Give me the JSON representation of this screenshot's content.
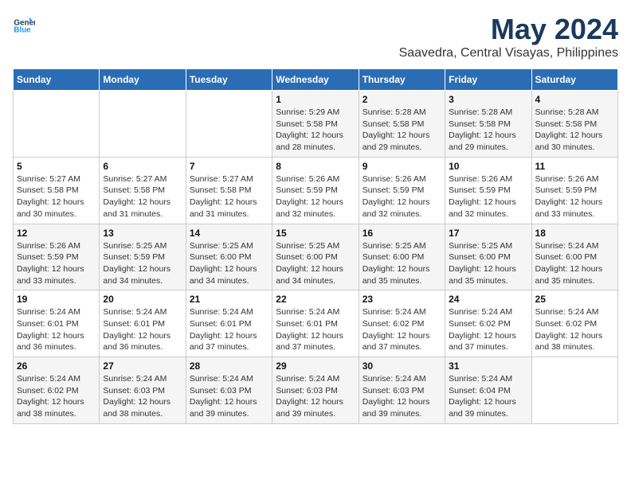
{
  "logo": {
    "line1": "General",
    "line2": "Blue"
  },
  "title": "May 2024",
  "location": "Saavedra, Central Visayas, Philippines",
  "days_of_week": [
    "Sunday",
    "Monday",
    "Tuesday",
    "Wednesday",
    "Thursday",
    "Friday",
    "Saturday"
  ],
  "weeks": [
    [
      {
        "day": "",
        "info": ""
      },
      {
        "day": "",
        "info": ""
      },
      {
        "day": "",
        "info": ""
      },
      {
        "day": "1",
        "sunrise": "5:29 AM",
        "sunset": "5:58 PM",
        "daylight": "12 hours and 28 minutes."
      },
      {
        "day": "2",
        "sunrise": "5:28 AM",
        "sunset": "5:58 PM",
        "daylight": "12 hours and 29 minutes."
      },
      {
        "day": "3",
        "sunrise": "5:28 AM",
        "sunset": "5:58 PM",
        "daylight": "12 hours and 29 minutes."
      },
      {
        "day": "4",
        "sunrise": "5:28 AM",
        "sunset": "5:58 PM",
        "daylight": "12 hours and 30 minutes."
      }
    ],
    [
      {
        "day": "5",
        "sunrise": "5:27 AM",
        "sunset": "5:58 PM",
        "daylight": "12 hours and 30 minutes."
      },
      {
        "day": "6",
        "sunrise": "5:27 AM",
        "sunset": "5:58 PM",
        "daylight": "12 hours and 31 minutes."
      },
      {
        "day": "7",
        "sunrise": "5:27 AM",
        "sunset": "5:58 PM",
        "daylight": "12 hours and 31 minutes."
      },
      {
        "day": "8",
        "sunrise": "5:26 AM",
        "sunset": "5:59 PM",
        "daylight": "12 hours and 32 minutes."
      },
      {
        "day": "9",
        "sunrise": "5:26 AM",
        "sunset": "5:59 PM",
        "daylight": "12 hours and 32 minutes."
      },
      {
        "day": "10",
        "sunrise": "5:26 AM",
        "sunset": "5:59 PM",
        "daylight": "12 hours and 32 minutes."
      },
      {
        "day": "11",
        "sunrise": "5:26 AM",
        "sunset": "5:59 PM",
        "daylight": "12 hours and 33 minutes."
      }
    ],
    [
      {
        "day": "12",
        "sunrise": "5:26 AM",
        "sunset": "5:59 PM",
        "daylight": "12 hours and 33 minutes."
      },
      {
        "day": "13",
        "sunrise": "5:25 AM",
        "sunset": "5:59 PM",
        "daylight": "12 hours and 34 minutes."
      },
      {
        "day": "14",
        "sunrise": "5:25 AM",
        "sunset": "6:00 PM",
        "daylight": "12 hours and 34 minutes."
      },
      {
        "day": "15",
        "sunrise": "5:25 AM",
        "sunset": "6:00 PM",
        "daylight": "12 hours and 34 minutes."
      },
      {
        "day": "16",
        "sunrise": "5:25 AM",
        "sunset": "6:00 PM",
        "daylight": "12 hours and 35 minutes."
      },
      {
        "day": "17",
        "sunrise": "5:25 AM",
        "sunset": "6:00 PM",
        "daylight": "12 hours and 35 minutes."
      },
      {
        "day": "18",
        "sunrise": "5:24 AM",
        "sunset": "6:00 PM",
        "daylight": "12 hours and 35 minutes."
      }
    ],
    [
      {
        "day": "19",
        "sunrise": "5:24 AM",
        "sunset": "6:01 PM",
        "daylight": "12 hours and 36 minutes."
      },
      {
        "day": "20",
        "sunrise": "5:24 AM",
        "sunset": "6:01 PM",
        "daylight": "12 hours and 36 minutes."
      },
      {
        "day": "21",
        "sunrise": "5:24 AM",
        "sunset": "6:01 PM",
        "daylight": "12 hours and 37 minutes."
      },
      {
        "day": "22",
        "sunrise": "5:24 AM",
        "sunset": "6:01 PM",
        "daylight": "12 hours and 37 minutes."
      },
      {
        "day": "23",
        "sunrise": "5:24 AM",
        "sunset": "6:02 PM",
        "daylight": "12 hours and 37 minutes."
      },
      {
        "day": "24",
        "sunrise": "5:24 AM",
        "sunset": "6:02 PM",
        "daylight": "12 hours and 37 minutes."
      },
      {
        "day": "25",
        "sunrise": "5:24 AM",
        "sunset": "6:02 PM",
        "daylight": "12 hours and 38 minutes."
      }
    ],
    [
      {
        "day": "26",
        "sunrise": "5:24 AM",
        "sunset": "6:02 PM",
        "daylight": "12 hours and 38 minutes."
      },
      {
        "day": "27",
        "sunrise": "5:24 AM",
        "sunset": "6:03 PM",
        "daylight": "12 hours and 38 minutes."
      },
      {
        "day": "28",
        "sunrise": "5:24 AM",
        "sunset": "6:03 PM",
        "daylight": "12 hours and 39 minutes."
      },
      {
        "day": "29",
        "sunrise": "5:24 AM",
        "sunset": "6:03 PM",
        "daylight": "12 hours and 39 minutes."
      },
      {
        "day": "30",
        "sunrise": "5:24 AM",
        "sunset": "6:03 PM",
        "daylight": "12 hours and 39 minutes."
      },
      {
        "day": "31",
        "sunrise": "5:24 AM",
        "sunset": "6:04 PM",
        "daylight": "12 hours and 39 minutes."
      },
      {
        "day": "",
        "info": ""
      }
    ]
  ]
}
